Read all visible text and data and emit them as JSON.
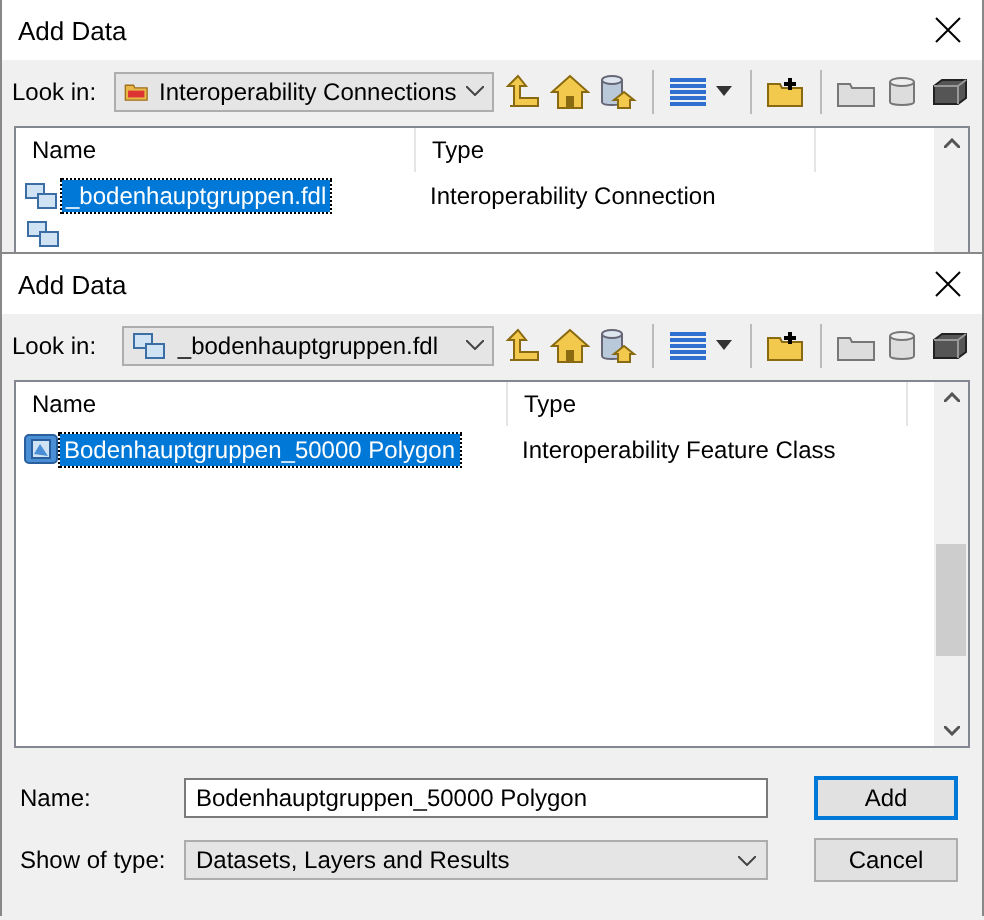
{
  "dialogs": [
    {
      "title": "Add Data",
      "look_in": {
        "label": "Look in:",
        "value": "Interoperability Connections",
        "kind": "folder"
      },
      "columns": [
        "Name",
        "Type"
      ],
      "rows": [
        {
          "kind": "connection",
          "name": "_bodenhauptgruppen.fdl",
          "type": "Interoperability Connection",
          "selected": true
        },
        {
          "kind": "connection_stub",
          "selected": false
        }
      ]
    },
    {
      "title": "Add Data",
      "look_in": {
        "label": "Look in:",
        "value": "_bodenhauptgruppen.fdl",
        "kind": "connection"
      },
      "columns": [
        "Name",
        "Type"
      ],
      "rows": [
        {
          "kind": "feature_class",
          "name": "Bodenhauptgruppen_50000 Polygon",
          "type": "Interoperability Feature Class",
          "selected": true
        }
      ],
      "footer": {
        "name_label": "Name:",
        "name_value": "Bodenhauptgruppen_50000 Polygon",
        "type_label": "Show of type:",
        "type_value": "Datasets, Layers and Results",
        "add": "Add",
        "cancel": "Cancel"
      }
    }
  ]
}
